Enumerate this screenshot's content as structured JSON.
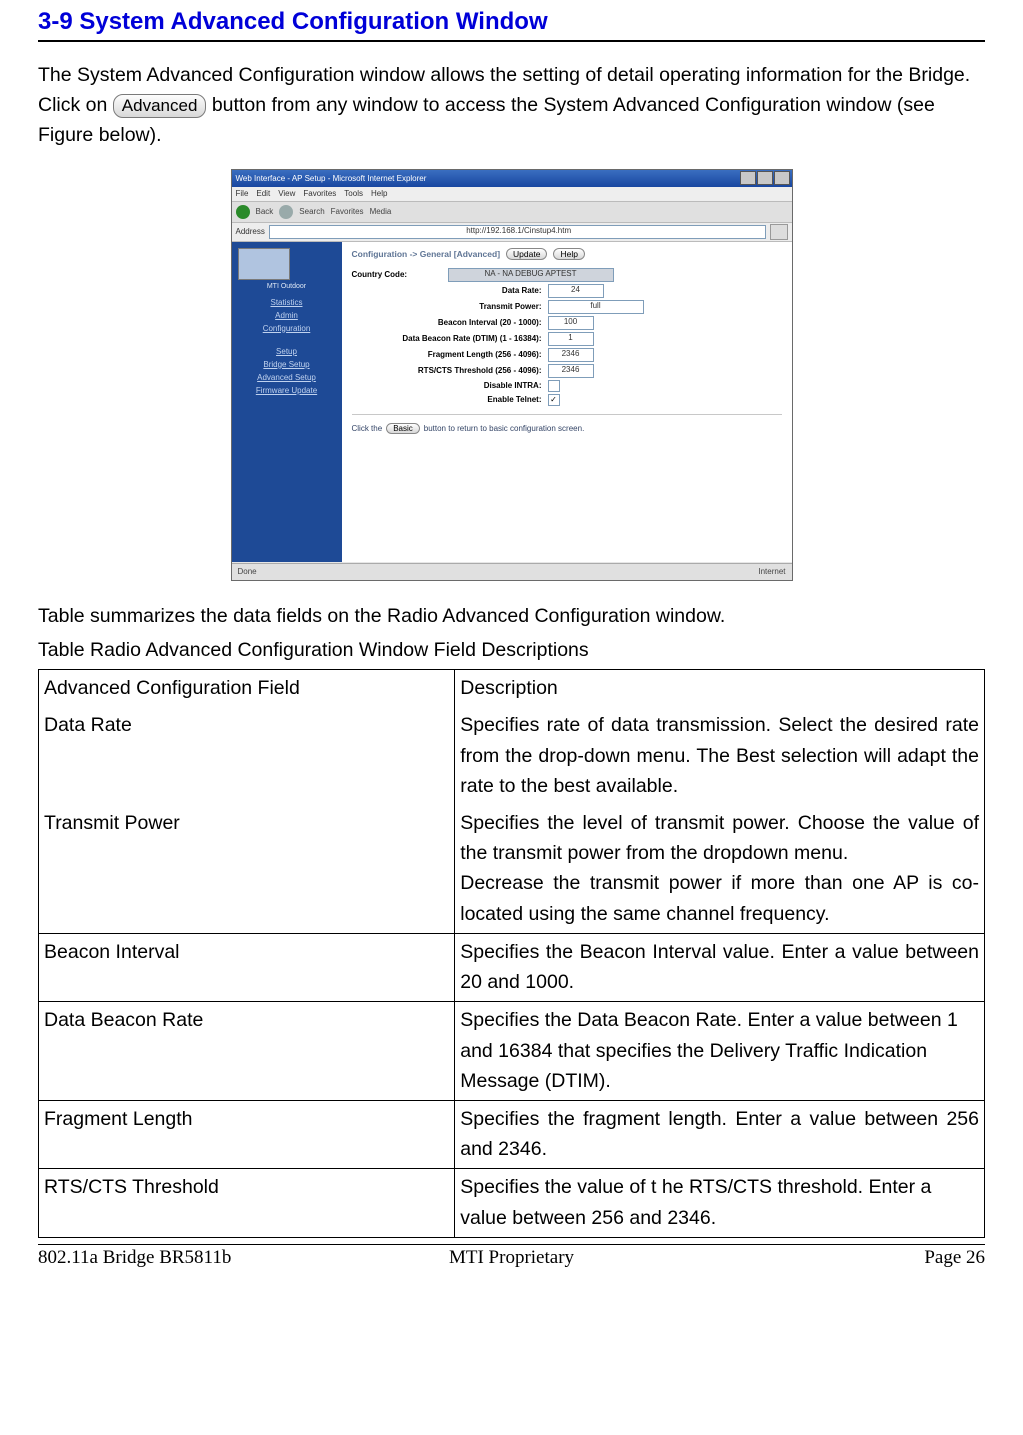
{
  "heading": "3-9 System Advanced Configuration Window",
  "intro": {
    "p1a": "The System Advanced Configuration window allows the setting of detail operating information for the Bridge. Click on ",
    "btn": "Advanced",
    "p1b": " button from any window to access the System Advanced Configuration window (see Figure below)."
  },
  "screenshot": {
    "title": "Web Interface - AP Setup - Microsoft Internet Explorer",
    "menu": [
      "File",
      "Edit",
      "View",
      "Favorites",
      "Tools",
      "Help"
    ],
    "toolbar": [
      "Back",
      "Search",
      "Favorites",
      "Media"
    ],
    "address_label": "Address",
    "address": "http://192.168.1/Cinstup4.htm",
    "sidebar_top": "MTI Outdoor",
    "sidebar": [
      "Statistics",
      "Admin",
      "Configuration",
      "Setup",
      "Bridge Setup",
      "Advanced Setup",
      "Firmware Update"
    ],
    "crumb": "Configuration -> General [Advanced]",
    "btn_update": "Update",
    "btn_help": "Help",
    "fields": {
      "country_label": "Country Code:",
      "country_value": "NA - NA DEBUG APTEST",
      "data_rate_label": "Data Rate:",
      "data_rate_value": "24",
      "tx_power_label": "Transmit Power:",
      "tx_power_value": "full",
      "beacon_label": "Beacon Interval (20 - 1000):",
      "beacon_value": "100",
      "dtim_label": "Data Beacon Rate (DTIM) (1 - 16384):",
      "dtim_value": "1",
      "frag_label": "Fragment Length (256 - 4096):",
      "frag_value": "2346",
      "rts_label": "RTS/CTS Threshold (256 - 4096):",
      "rts_value": "2346",
      "intra_label": "Disable INTRA:",
      "telnet_label": "Enable Telnet:"
    },
    "basic_btn": "Basic",
    "basic_hint_a": "Click the",
    "basic_hint_b": "button to return to basic configuration screen.",
    "status_left": "Done",
    "status_right": "Internet"
  },
  "summary": "Table summarizes the data fields on the Radio Advanced Configuration window.",
  "tcaption": "Table Radio Advanced Configuration Window Field Descriptions",
  "table": {
    "h1": "Advanced Configuration Field",
    "h2": "Description",
    "r1f": "Data Rate",
    "r1d": "Specifies rate of data transmission. Select the desired rate from the drop-down menu. The Best selection will adapt the rate to the best available.",
    "r2f": "Transmit Power",
    "r2d": "Specifies the level of transmit power. Choose the value of the transmit power from the dropdown menu.",
    "r2d2": "Decrease the transmit power if more than one AP is co-located using the same channel frequency.",
    "r3f": "Beacon Interval",
    "r3d": "Specifies the Beacon Interval value. Enter a value between 20 and 1000.",
    "r4f": "Data Beacon Rate",
    "r4d": "Specifies the Data Beacon Rate. Enter a value between 1 and 16384 that specifies the Delivery Traffic Indication Message (DTIM).",
    "r5f": "Fragment Length",
    "r5d": "Specifies the fragment length. Enter a value between 256 and 2346.",
    "r6f": "RTS/CTS Threshold",
    "r6d": "Specifies the value of t he RTS/CTS threshold. Enter a value between 256 and 2346."
  },
  "footer": {
    "left": "802.11a Bridge  BR5811b",
    "center": "MTI Proprietary",
    "right": "Page 26"
  }
}
